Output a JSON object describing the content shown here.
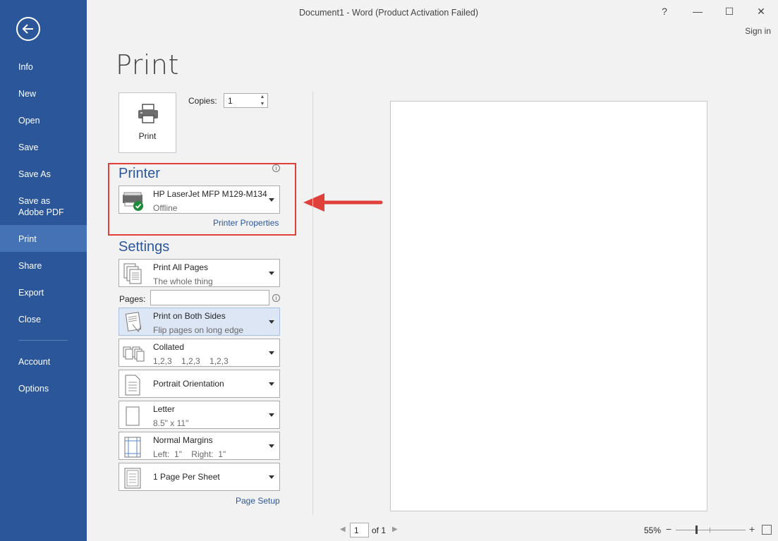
{
  "window": {
    "title": "Document1 - Word (Product Activation Failed)",
    "help": "?",
    "minimize": "—",
    "maximize": "☐",
    "close": "✕",
    "sign_in": "Sign in"
  },
  "sidebar": {
    "items": [
      {
        "label": "Info"
      },
      {
        "label": "New"
      },
      {
        "label": "Open"
      },
      {
        "label": "Save"
      },
      {
        "label": "Save As"
      },
      {
        "label": "Save as Adobe PDF"
      },
      {
        "label": "Print",
        "active": true
      },
      {
        "label": "Share"
      },
      {
        "label": "Export"
      },
      {
        "label": "Close"
      },
      {
        "label": "Account"
      },
      {
        "label": "Options"
      }
    ]
  },
  "page_title": "Print",
  "print_button": {
    "label": "Print"
  },
  "copies": {
    "label": "Copies:",
    "value": "1"
  },
  "printer": {
    "heading": "Printer",
    "name": "HP LaserJet MFP M129-M134",
    "status": "Offline",
    "properties_link": "Printer Properties"
  },
  "settings": {
    "heading": "Settings",
    "print_pages": {
      "main": "Print All Pages",
      "sub": "The whole thing"
    },
    "pages_label": "Pages:",
    "pages_value": "",
    "sides": {
      "main": "Print on Both Sides",
      "sub": "Flip pages on long edge"
    },
    "collated": {
      "main": "Collated",
      "sub": "1,2,3    1,2,3    1,2,3"
    },
    "orientation": {
      "main": "Portrait Orientation"
    },
    "paper": {
      "main": "Letter",
      "sub": "8.5\" x 11\""
    },
    "margins": {
      "main": "Normal Margins",
      "sub": "Left:  1\"    Right:  1\""
    },
    "per_sheet": {
      "main": "1 Page Per Sheet"
    },
    "page_setup_link": "Page Setup"
  },
  "preview_nav": {
    "page": "1",
    "of": "of 1",
    "zoom": "55%"
  },
  "colors": {
    "sidebar": "#2b579a",
    "sidebar_active": "#4472b4",
    "highlight_box": "#e0403a"
  }
}
